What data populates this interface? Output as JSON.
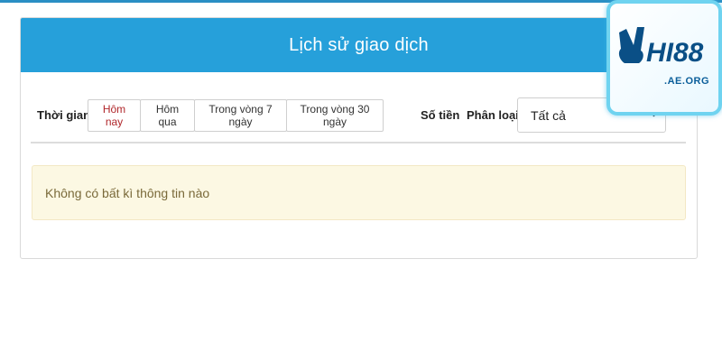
{
  "panel": {
    "title": "Lịch sử giao dịch"
  },
  "filters": {
    "time_label": "Thời gian",
    "time_options": [
      {
        "label": "Hôm nay",
        "active": true
      },
      {
        "label": "Hôm qua",
        "active": false
      },
      {
        "label": "Trong vòng 7 ngày",
        "active": false
      },
      {
        "label": "Trong vòng 30 ngày",
        "active": false
      }
    ],
    "amount_label": "Số tiền",
    "category_label": "Phân loại",
    "category_selected": "Tất cả"
  },
  "alert": {
    "message": "Không có bất kì thông tin nào"
  },
  "logo": {
    "brand": "HI88",
    "domain": ".AE.ORG"
  },
  "colors": {
    "header_bg": "#26a0da",
    "active_text": "#b0272b",
    "alert_bg": "#fcf8e3"
  }
}
